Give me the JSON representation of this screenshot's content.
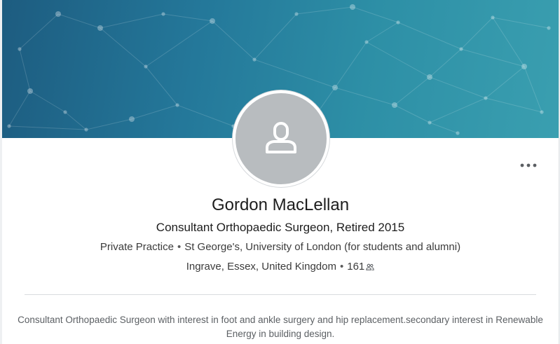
{
  "profile": {
    "name": "Gordon MacLellan",
    "headline": "Consultant Orthopaedic Surgeon, Retired 2015",
    "company": "Private Practice",
    "education": "St George's, University of London (for students and alumni)",
    "location": "Ingrave, Essex, United Kingdom",
    "connections": "161",
    "summary": "Consultant Orthopaedic Surgeon with interest in foot and ankle surgery and hip replacement.secondary interest in Renewable Energy in building design."
  },
  "separator": "•",
  "icons": {
    "avatar": "person-silhouette-icon",
    "more": "more-horizontal-icon",
    "connections": "people-icon"
  },
  "colors": {
    "banner_start": "#1d5c80",
    "banner_end": "#3a9fb0",
    "avatar_bg": "#b8bcbf"
  }
}
